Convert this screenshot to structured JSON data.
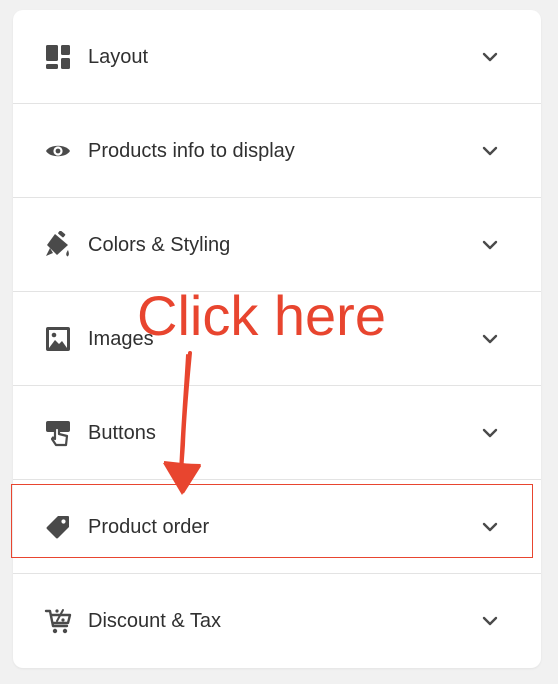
{
  "accordion": {
    "items": [
      {
        "label": "Layout",
        "icon": "layout-icon"
      },
      {
        "label": "Products info to display",
        "icon": "eye-icon"
      },
      {
        "label": "Colors & Styling",
        "icon": "paint-bucket-icon"
      },
      {
        "label": "Images",
        "icon": "image-icon"
      },
      {
        "label": "Buttons",
        "icon": "button-press-icon"
      },
      {
        "label": "Product order",
        "icon": "tag-icon"
      },
      {
        "label": "Discount & Tax",
        "icon": "cart-discount-icon"
      }
    ]
  },
  "annotation": {
    "text": "Click here",
    "color": "#e8452f"
  },
  "colors": {
    "icon": "#4a4a4a",
    "text": "#303030",
    "divider": "#e3e3e3"
  }
}
